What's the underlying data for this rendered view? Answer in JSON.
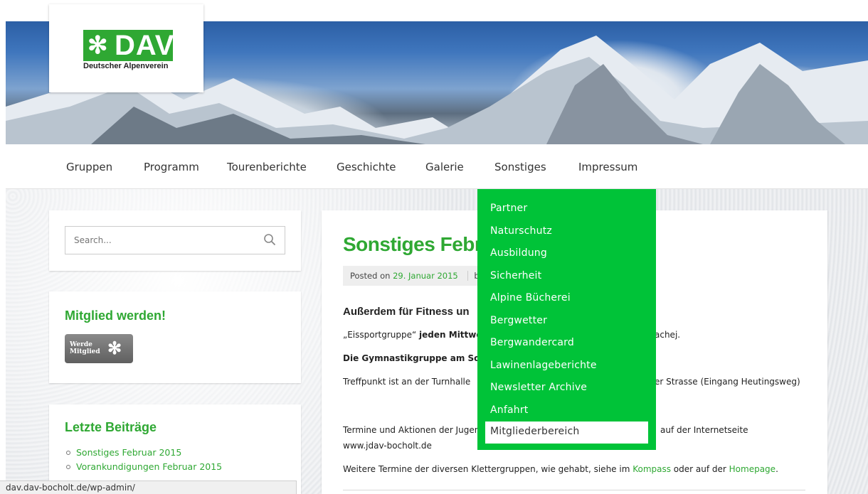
{
  "header": {
    "logo_text": "DAV",
    "logo_subtitle": "Deutscher Alpenverein"
  },
  "nav": {
    "items": [
      "Gruppen",
      "Programm",
      "Tourenberichte",
      "Geschichte",
      "Galerie",
      "Sonstiges",
      "Impressum"
    ]
  },
  "dropdown": {
    "items": [
      "Partner",
      "Naturschutz",
      "Ausbildung",
      "Sicherheit",
      "Alpine Bücherei",
      "Bergwetter",
      "Bergwandercard",
      "Lawinenlageberichte",
      "Newsletter Archive",
      "Anfahrt",
      "Mitgliederbereich"
    ],
    "active_index": 10
  },
  "sidebar": {
    "search_placeholder": "Search...",
    "member_title": "Mitglied werden!",
    "member_badge_line1": "Werde",
    "member_badge_line2": "Mitglied",
    "recent_title": "Letzte Beiträge",
    "recent_posts": [
      "Sonstiges Februar 2015",
      "Vorankundigungen Februar 2015"
    ]
  },
  "article": {
    "title": "Sonstiges Febr",
    "meta_prefix": "Posted on ",
    "meta_date": "29. Januar 2015",
    "meta_by": "b",
    "heading": "Außerdem für Fitness un",
    "p1_start": "„Eissportgruppe“ ",
    "p1_bold": "jeden Mittwoc",
    "p1_end": "achej.",
    "p2": "Die Gymnastikgruppe am Sonnt",
    "p3_start": "Treffpunkt ist an der Turnhalle",
    "p3_end": "er Strasse (Eingang Heutingsweg)",
    "p4_start": "Termine und Aktionen der Jugen",
    "p4_end": "auf der Internetseite",
    "p4_link": "www.jdav-bocholt.de",
    "p5_start": "Weitere Termine der diversen Klettergruppen, wie gehabt, siehe im ",
    "p5_link1": "Kompass",
    "p5_mid": " oder auf der ",
    "p5_link2": "Homepage",
    "p5_end": "."
  },
  "status_bar": {
    "url": "dav.dav-bocholt.de/wp-admin/"
  },
  "colors": {
    "brand_green": "#2fa833",
    "dropdown_green": "#00c338"
  }
}
